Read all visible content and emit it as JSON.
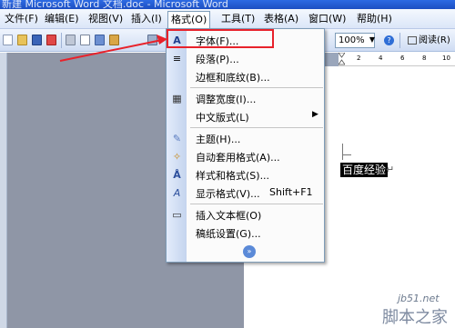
{
  "window": {
    "title": "新建 Microsoft Word 文档.doc - Microsoft Word"
  },
  "menubar": {
    "items": [
      {
        "label": "文件(F)"
      },
      {
        "label": "编辑(E)"
      },
      {
        "label": "视图(V)"
      },
      {
        "label": "插入(I)"
      },
      {
        "label": "格式(O)"
      },
      {
        "label": "工具(T)"
      },
      {
        "label": "表格(A)"
      },
      {
        "label": "窗口(W)"
      },
      {
        "label": "帮助(H)"
      }
    ],
    "active": "格式(O)"
  },
  "toolbar": {
    "zoom_value": "100%",
    "zoom_arrow": "▼",
    "help_icon": "?",
    "read_label": "阅读(R)"
  },
  "format_menu": {
    "items": [
      {
        "label": "字体(F)...",
        "icon": "font-icon",
        "glyph": "A"
      },
      {
        "label": "段落(P)...",
        "icon": "paragraph-icon",
        "glyph": "≡"
      },
      {
        "label": "边框和底纹(B)...",
        "icon": "",
        "glyph": ""
      },
      {
        "label": "调整宽度(I)...",
        "icon": "fit-width-icon",
        "glyph": "▦"
      },
      {
        "label": "中文版式(L)",
        "icon": "",
        "glyph": "",
        "arrow": "▶"
      },
      {
        "label": "主题(H)...",
        "icon": "theme-icon",
        "glyph": "✎"
      },
      {
        "label": "自动套用格式(A)...",
        "icon": "autoformat-icon",
        "glyph": "✧"
      },
      {
        "label": "样式和格式(S)...",
        "icon": "styles-icon",
        "glyph": "Å"
      },
      {
        "label": "显示格式(V)...",
        "icon": "reveal-format-icon",
        "glyph": "A"
      },
      {
        "label": "插入文本框(O)",
        "icon": "textbox-icon",
        "glyph": "▭"
      },
      {
        "label": "稿纸设置(G)...",
        "icon": "",
        "glyph": ""
      }
    ],
    "reveal_shortcut": "Shift+F1",
    "expand_glyph": "»"
  },
  "ruler": {
    "ticks": [
      "2",
      "4",
      "6",
      "8",
      "10"
    ]
  },
  "document": {
    "selected_text": "百度经验",
    "paragraph_mark": "↵"
  },
  "watermark": {
    "url": "jb51.net",
    "name": "脚本之家"
  },
  "colors": {
    "highlight": "#e8222b",
    "menu_border": "#7f9db9",
    "selection_bg": "#000000"
  }
}
